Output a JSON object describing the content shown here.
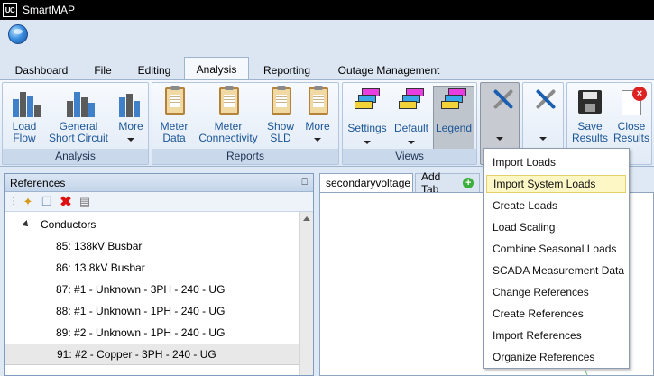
{
  "window": {
    "logo_text": "UC",
    "title": "SmartMAP"
  },
  "tabs": [
    {
      "label": "Dashboard"
    },
    {
      "label": "File"
    },
    {
      "label": "Editing"
    },
    {
      "label": "Analysis",
      "active": true
    },
    {
      "label": "Reporting"
    },
    {
      "label": "Outage Management"
    }
  ],
  "ribbon": {
    "analysis": {
      "label": "Analysis",
      "load_flow": "Load\nFlow",
      "general_short_circuit": "General\nShort Circuit",
      "more": "More"
    },
    "reports": {
      "label": "Reports",
      "meter_data": "Meter\nData",
      "meter_connectivity": "Meter\nConnectivity",
      "show_sld": "Show\nSLD",
      "more": "More"
    },
    "views": {
      "label": "Views",
      "settings": "Settings",
      "default": "Default",
      "legend": "Legend"
    },
    "save_results": "Save\nResults",
    "close_results": "Close\nResults"
  },
  "references": {
    "title": "References",
    "pin_glyph": "⎕",
    "toolbar_icons": [
      "add-reference-icon",
      "copy-icon",
      "delete-icon",
      "properties-icon"
    ],
    "group": "Conductors",
    "items": [
      "85: 138kV Busbar",
      "86: 13.8kV Busbar",
      "87: #1 - Unknown - 3PH - 240 - UG",
      "88: #1 - Unknown - 1PH - 240 - UG",
      "89: #2 - Unknown - 1PH - 240 - UG",
      "91: #2 - Copper - 3PH - 240 - UG"
    ],
    "selected_index": 5
  },
  "document_tabs": {
    "active": "secondaryvoltage",
    "add": "Add Tab"
  },
  "dropdown_menu": {
    "items": [
      "Import Loads",
      "Import System Loads",
      "Create Loads",
      "Load Scaling",
      "Combine Seasonal Loads",
      "SCADA Measurement Data",
      "Change References",
      "Create References",
      "Import References",
      "Organize References"
    ],
    "highlighted_index": 1
  },
  "colors": {
    "accent_blue": "#1a5596",
    "highlight": "#fdf6c5",
    "title_bar": "#000000"
  }
}
